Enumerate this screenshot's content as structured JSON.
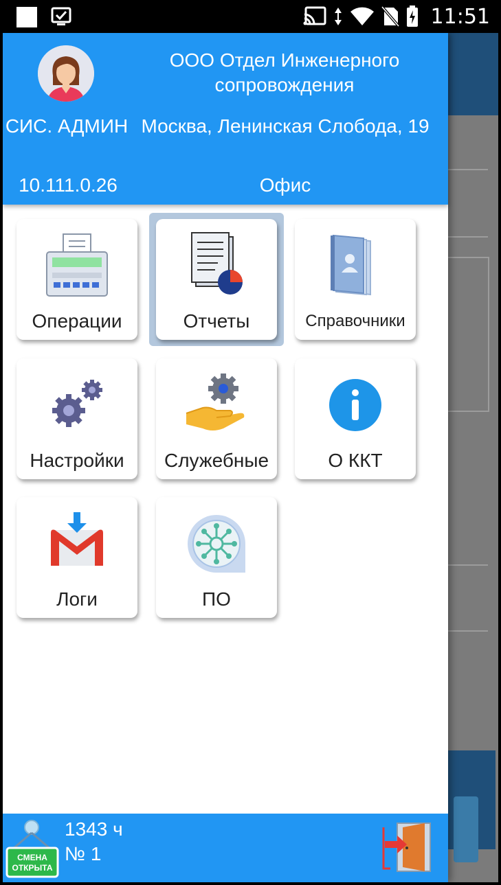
{
  "status_bar": {
    "time": "11:51",
    "icons": [
      "notification-square-icon",
      "checkbox-icon",
      "cast-icon",
      "data-arrows-icon",
      "wifi-icon",
      "no-sim-icon",
      "battery-charging-icon"
    ]
  },
  "header": {
    "user_name": "СИС. АДМИН",
    "ip_address": "10.111.0.26",
    "org_name": "ООО Отдел Инженерного сопровождения",
    "address": "Москва, Ленинская Слобода, 19",
    "place": "Офис",
    "avatar_icon": "user-avatar-icon"
  },
  "menu": [
    {
      "label": "Операции",
      "icon": "cash-register-icon"
    },
    {
      "label": "Отчеты",
      "icon": "report-chart-icon",
      "selected": true
    },
    {
      "label": "Справочники",
      "icon": "directory-book-icon"
    },
    {
      "label": "Настройки",
      "icon": "gears-icon"
    },
    {
      "label": "Служебные",
      "icon": "service-hand-gear-icon"
    },
    {
      "label": "О ККТ",
      "icon": "info-icon"
    },
    {
      "label": "Логи",
      "icon": "mail-logs-icon"
    },
    {
      "label": "ПО",
      "icon": "software-icon"
    }
  ],
  "footer": {
    "badge_line1": "СМЕНА",
    "badge_line2": "ОТКРЫТА",
    "hours": "1343 ч",
    "shift_number": "№ 1",
    "exit_icon": "exit-door-icon"
  },
  "colors": {
    "primary": "#2196f3",
    "header_text": "#ffffff",
    "selected_tile_bg": "#b3c7dd",
    "badge_green": "#2db84a"
  }
}
